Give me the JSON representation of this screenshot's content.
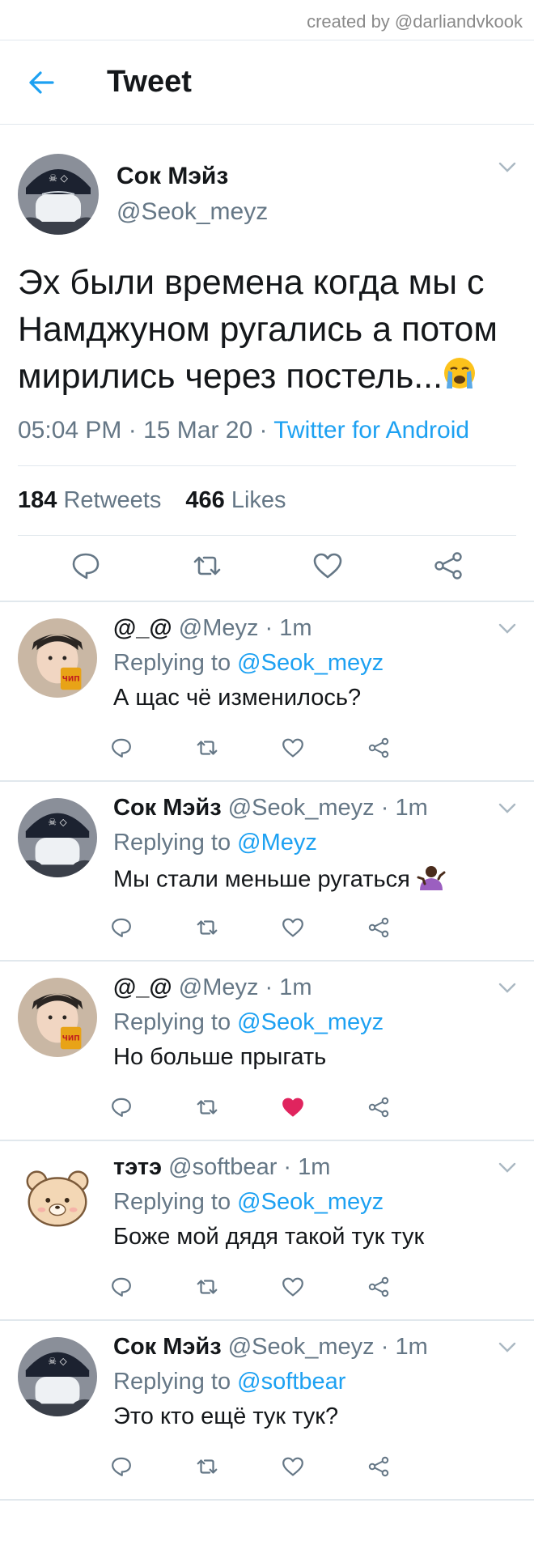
{
  "credit": "created by @darliandvkook",
  "header": {
    "title": "Tweet"
  },
  "main_tweet": {
    "name": "Сок Мэйз",
    "handle": "@Seok_meyz",
    "text": "Эх были времена когда мы с Намджуном ругались а потом мирились через постель...",
    "time": "05:04 PM · 15 Mar 20 · ",
    "source": "Twitter for Android",
    "retweets_count": "184",
    "retweets_label": "Retweets",
    "likes_count": "466",
    "likes_label": "Likes"
  },
  "replies": [
    {
      "name": "@_@",
      "handle": "@Meyz",
      "time": " · 1m",
      "replying_label": "Replying to ",
      "replying_to": "@Seok_meyz",
      "text": "А щас чё изменилось?",
      "liked": false,
      "avatar": "rm"
    },
    {
      "name": "Сок Мэйз",
      "handle": "@Seok_meyz",
      "time": " · 1m",
      "replying_label": "Replying to ",
      "replying_to": "@Meyz",
      "text": "Мы стали меньше ругаться",
      "liked": false,
      "avatar": "jin"
    },
    {
      "name": "@_@",
      "handle": "@Meyz",
      "time": " · 1m",
      "replying_label": "Replying to ",
      "replying_to": "@Seok_meyz",
      "text": "Но больше прыгать",
      "liked": true,
      "avatar": "rm"
    },
    {
      "name": "тэтэ",
      "handle": "@softbear",
      "time": " · 1m",
      "replying_label": "Replying to ",
      "replying_to": "@Seok_meyz",
      "text": "Боже мой дядя такой тук тук",
      "liked": false,
      "avatar": "bear"
    },
    {
      "name": "Сок Мэйз",
      "handle": "@Seok_meyz",
      "time": " · 1m",
      "replying_label": "Replying to ",
      "replying_to": "@softbear",
      "text": "Это кто ещё тук тук?",
      "liked": false,
      "avatar": "jin"
    }
  ],
  "colors": {
    "accent": "#1da1f2",
    "secondary": "#657786",
    "like_active": "#e0245e",
    "divider": "#e1e8ed"
  }
}
